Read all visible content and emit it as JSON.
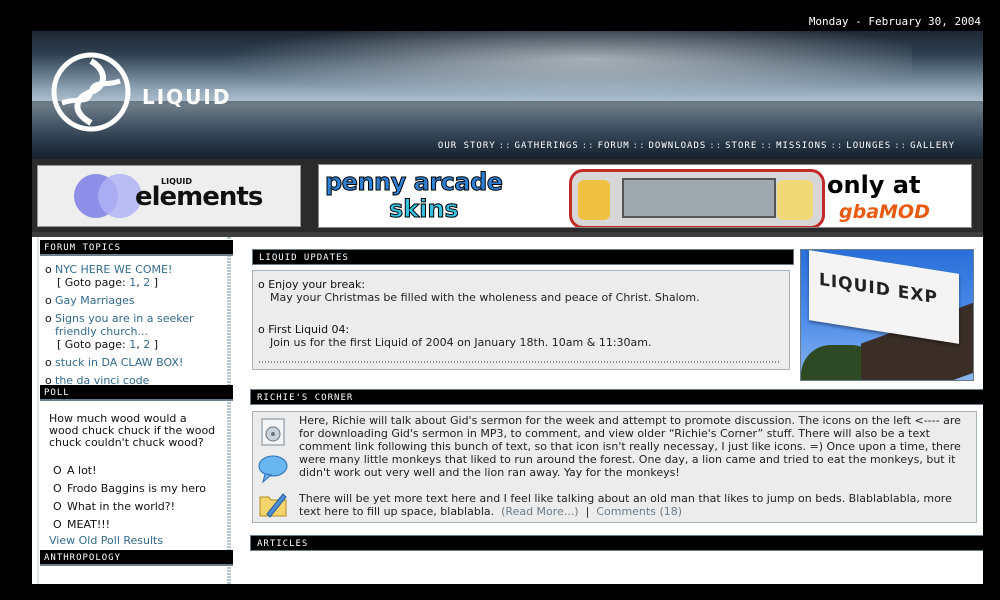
{
  "date": "Monday - February 30, 2004",
  "logo": {
    "text": "LIQUID"
  },
  "nav": [
    "OUR STORY",
    "GATHERINGS",
    "FORUM",
    "DOWNLOADS",
    "STORE",
    "MISSIONS",
    "LOUNGES",
    "GALLERY"
  ],
  "nav_separator": "::",
  "ads": {
    "left": {
      "small": "LIQUID",
      "main": "elements"
    },
    "right": {
      "line1": "penny arcade",
      "line2": "skins",
      "line3": "only at",
      "brand": "gbaMOD"
    }
  },
  "sidebar": {
    "forum_title": "FORUM TOPICS",
    "bullet": "o",
    "topics": [
      {
        "title": "NYC HERE WE COME!",
        "goto": "[ Goto page: ",
        "pages": [
          "1",
          "2"
        ],
        "close": " ]"
      },
      {
        "title": "Gay Marriages"
      },
      {
        "title": "Signs you are in a seeker friendly church...",
        "goto": "[ Goto page: ",
        "pages": [
          "1",
          "2"
        ],
        "close": " ]"
      },
      {
        "title": "stuck in DA CLAW BOX!"
      },
      {
        "title": "the da vinci code"
      }
    ],
    "poll_title": "POLL",
    "poll_question": "How much wood would a wood chuck chuck if the wood chuck couldn't chuck wood?",
    "poll_options": [
      "A lot!",
      "Frodo Baggins is my hero",
      "What in the world?!",
      "MEAT!!!"
    ],
    "poll_option_marker": "O",
    "poll_link": "View Old Poll Results",
    "anthro_title": "ANTHROPOLOGY"
  },
  "updates": {
    "title": "LIQUID UPDATES",
    "items": [
      {
        "title": "Enjoy your break:",
        "body": "May your Christmas be filled with the wholeness and peace of Christ. Shalom."
      },
      {
        "title": "First Liquid 04:",
        "body": "Join us for the first Liquid of 2004 on January 18th. 10am & 11:30am."
      }
    ]
  },
  "flag_text": "LIQUID EXP",
  "richie": {
    "title": "RICHIE'S CORNER",
    "p1": "Here, Richie will talk about Gid's sermon for the week and attempt to promote discussion.  The icons on the left <---- are for downloading Gid's sermon in MP3, to comment, and view older “Richie's Corner” stuff.  There will also be a text comment link following this bunch of text, so that icon isn't really necessay, I just like icons. =)  Once upon a time, there were many little monkeys that liked to run around the forest.  One day, a lion came and tried to eat the monkeys, but it didn't work out very well and the lion ran away.  Yay for the monkeys!",
    "p2": "There will be yet more text here and I feel like talking about an old man that likes to jump on beds.  Blablablabla, more text here to fill up space, blablabla.",
    "read_more": "(Read More...)",
    "sep": "|",
    "comments": "Comments (18)"
  },
  "articles": {
    "title": "ARTICLES"
  }
}
